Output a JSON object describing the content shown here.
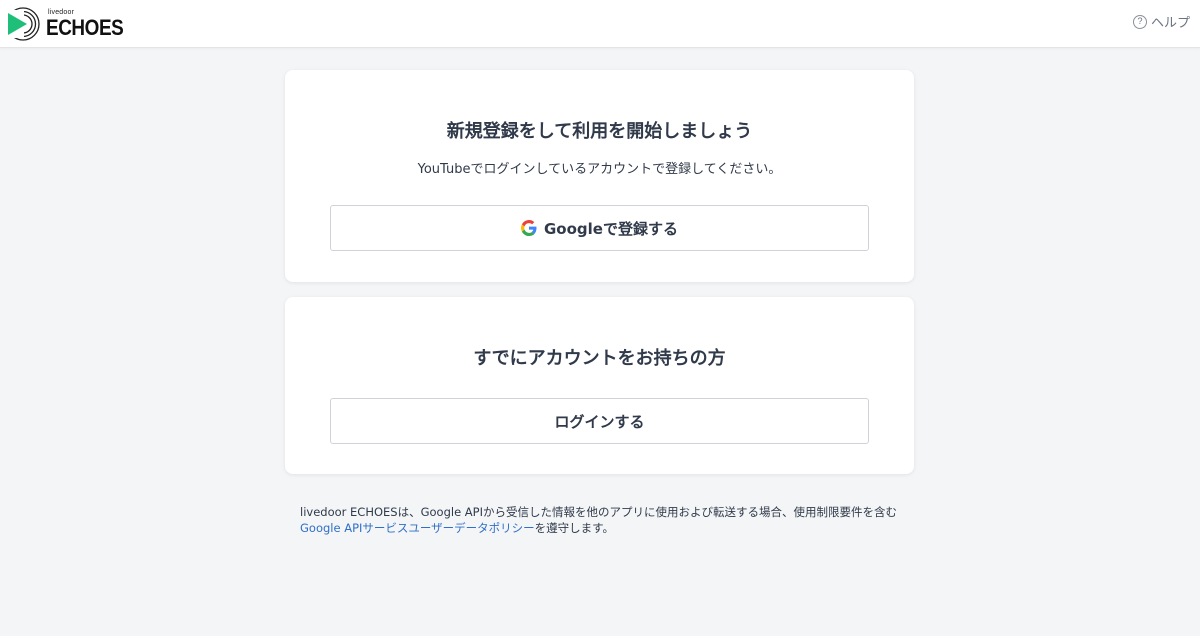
{
  "header": {
    "logo_sub": "livedoor",
    "logo_main": "ECHOES",
    "help_label": "ヘルプ",
    "help_icon": "question-circle-icon",
    "brand_color": "#1fbf7a"
  },
  "signup": {
    "title": "新規登録をして利用を開始しましょう",
    "description": "YouTubeでログインしているアカウントで登録してください。",
    "google_button_label": "Googleで登録する",
    "google_icon": "google-g-icon"
  },
  "login": {
    "title": "すでにアカウントをお持ちの方",
    "button_label": "ログインする"
  },
  "notice": {
    "text_before": "livedoor ECHOESは、Google APIから受信した情報を他のアプリに使用および転送する場合、使用制限要件を含む",
    "link_text": "Google APIサービスユーザーデータポリシー",
    "text_after": "を遵守します。",
    "link_color": "#2f6fc7"
  }
}
